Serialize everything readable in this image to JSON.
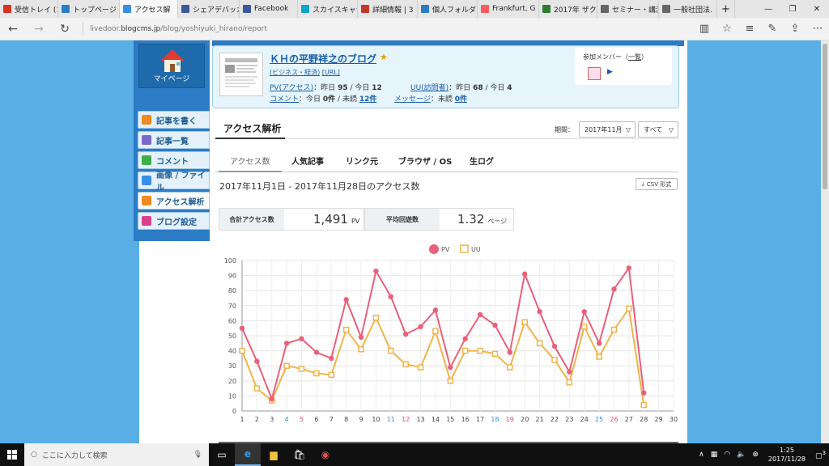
{
  "browser": {
    "tabs": [
      {
        "label": "受信トレイ (1",
        "color": "#d93025"
      },
      {
        "label": "トップページ -",
        "color": "#2b7cc4"
      },
      {
        "label": "アクセス解",
        "color": "#3a8ee6",
        "active": true
      },
      {
        "label": "シェアデバッガ",
        "color": "#3b5998"
      },
      {
        "label": "Facebook",
        "color": "#3b5998"
      },
      {
        "label": "スカイスキャナ",
        "color": "#0ea5c6"
      },
      {
        "label": "詳細情報 | 3",
        "color": "#c0392b"
      },
      {
        "label": "個人フォルダ",
        "color": "#2b7cc4"
      },
      {
        "label": "Frankfurt, G",
        "color": "#ff5a5f"
      },
      {
        "label": "2017年 ザク",
        "color": "#2e7d32"
      },
      {
        "label": "セミナー・講演",
        "color": "#666666"
      },
      {
        "label": "一般社団法.",
        "color": "#666666"
      }
    ],
    "new_tab": "+",
    "url_prefix": "livedoor.",
    "url_domain": "blogcms.jp",
    "url_path": "/blog/yoshiyuki_hirano/report"
  },
  "sidebar": {
    "mypage": "マイページ",
    "items": [
      {
        "label": "記事を書く",
        "icon": "pencil-icon"
      },
      {
        "label": "記事一覧",
        "icon": "documents-icon"
      },
      {
        "label": "コメント",
        "icon": "speech-bubble-icon"
      },
      {
        "label": "画像 / ファイル",
        "icon": "image-icon"
      },
      {
        "label": "アクセス解析",
        "icon": "bar-chart-icon"
      },
      {
        "label": "ブログ設定",
        "icon": "wrench-icon"
      }
    ]
  },
  "blog": {
    "title": "ＫＨの平野祥之のブログ",
    "category": "(ビジネス・経済)",
    "url_link": "[URL]",
    "pv_label": "PV(アクセス)",
    "pv_text": "：昨日",
    "pv_yesterday": "95",
    "pv_today_text": "/ 今日",
    "pv_today": "12",
    "uu_label": "UU(訪問者)",
    "uu_text": "：昨日",
    "uu_yesterday": "68",
    "uu_today_text": "/ 今日",
    "uu_today": "4",
    "comment_label": "コメント",
    "comment_text": "：今日",
    "comment_today": "0件",
    "comment_unread_text": "/ 未読",
    "comment_unread": "12件",
    "message_label": "メッセージ",
    "message_text": "：未読",
    "message_unread": "0件",
    "members_label": "参加メンバー（",
    "members_link": "一覧",
    "members_close": "）"
  },
  "report": {
    "title": "アクセス解析",
    "period_label": "期間：",
    "period_value": "2017年11月",
    "scope_value": "すべて",
    "tabs": [
      "アクセス数",
      "人気記事",
      "リンク元",
      "ブラウザ / OS",
      "生ログ"
    ],
    "date_range": "2017年11月1日 - 2017年11月28日のアクセス数",
    "csv_label": "CSV 形式",
    "total_label": "合計アクセス数",
    "total_value": "1,491",
    "total_unit": "PV",
    "avg_label": "平均回遊数",
    "avg_value": "1.32",
    "avg_unit": "ページ"
  },
  "chart_data": {
    "type": "line",
    "x": [
      1,
      2,
      3,
      4,
      5,
      6,
      7,
      8,
      9,
      10,
      11,
      12,
      13,
      14,
      15,
      16,
      17,
      18,
      19,
      20,
      21,
      22,
      23,
      24,
      25,
      26,
      27,
      28,
      29,
      30
    ],
    "series": [
      {
        "name": "PV",
        "color": "#e8607a",
        "values": [
          55,
          33,
          8,
          45,
          48,
          39,
          35,
          74,
          49,
          93,
          76,
          51,
          56,
          67,
          29,
          48,
          64,
          57,
          39,
          91,
          66,
          43,
          26,
          66,
          45,
          81,
          95,
          12,
          null,
          null
        ]
      },
      {
        "name": "UU",
        "color": "#f0b44a",
        "values": [
          40,
          15,
          7,
          30,
          28,
          25,
          24,
          54,
          41,
          62,
          40,
          31,
          29,
          53,
          20,
          40,
          40,
          38,
          29,
          59,
          45,
          34,
          19,
          56,
          36,
          54,
          68,
          4,
          null,
          null
        ]
      }
    ],
    "ylim": [
      0,
      100
    ],
    "yticks": [
      0,
      10,
      20,
      30,
      40,
      50,
      60,
      70,
      80,
      90,
      100
    ],
    "saturday_days": [
      4,
      11,
      18,
      25
    ],
    "sunday_days": [
      5,
      12,
      19,
      26
    ],
    "legend": "top-center",
    "grid": true
  },
  "taskbar": {
    "search_placeholder": "ここに入力して検索",
    "time": "1:25",
    "date": "2017/11/28",
    "notifications": "3"
  }
}
